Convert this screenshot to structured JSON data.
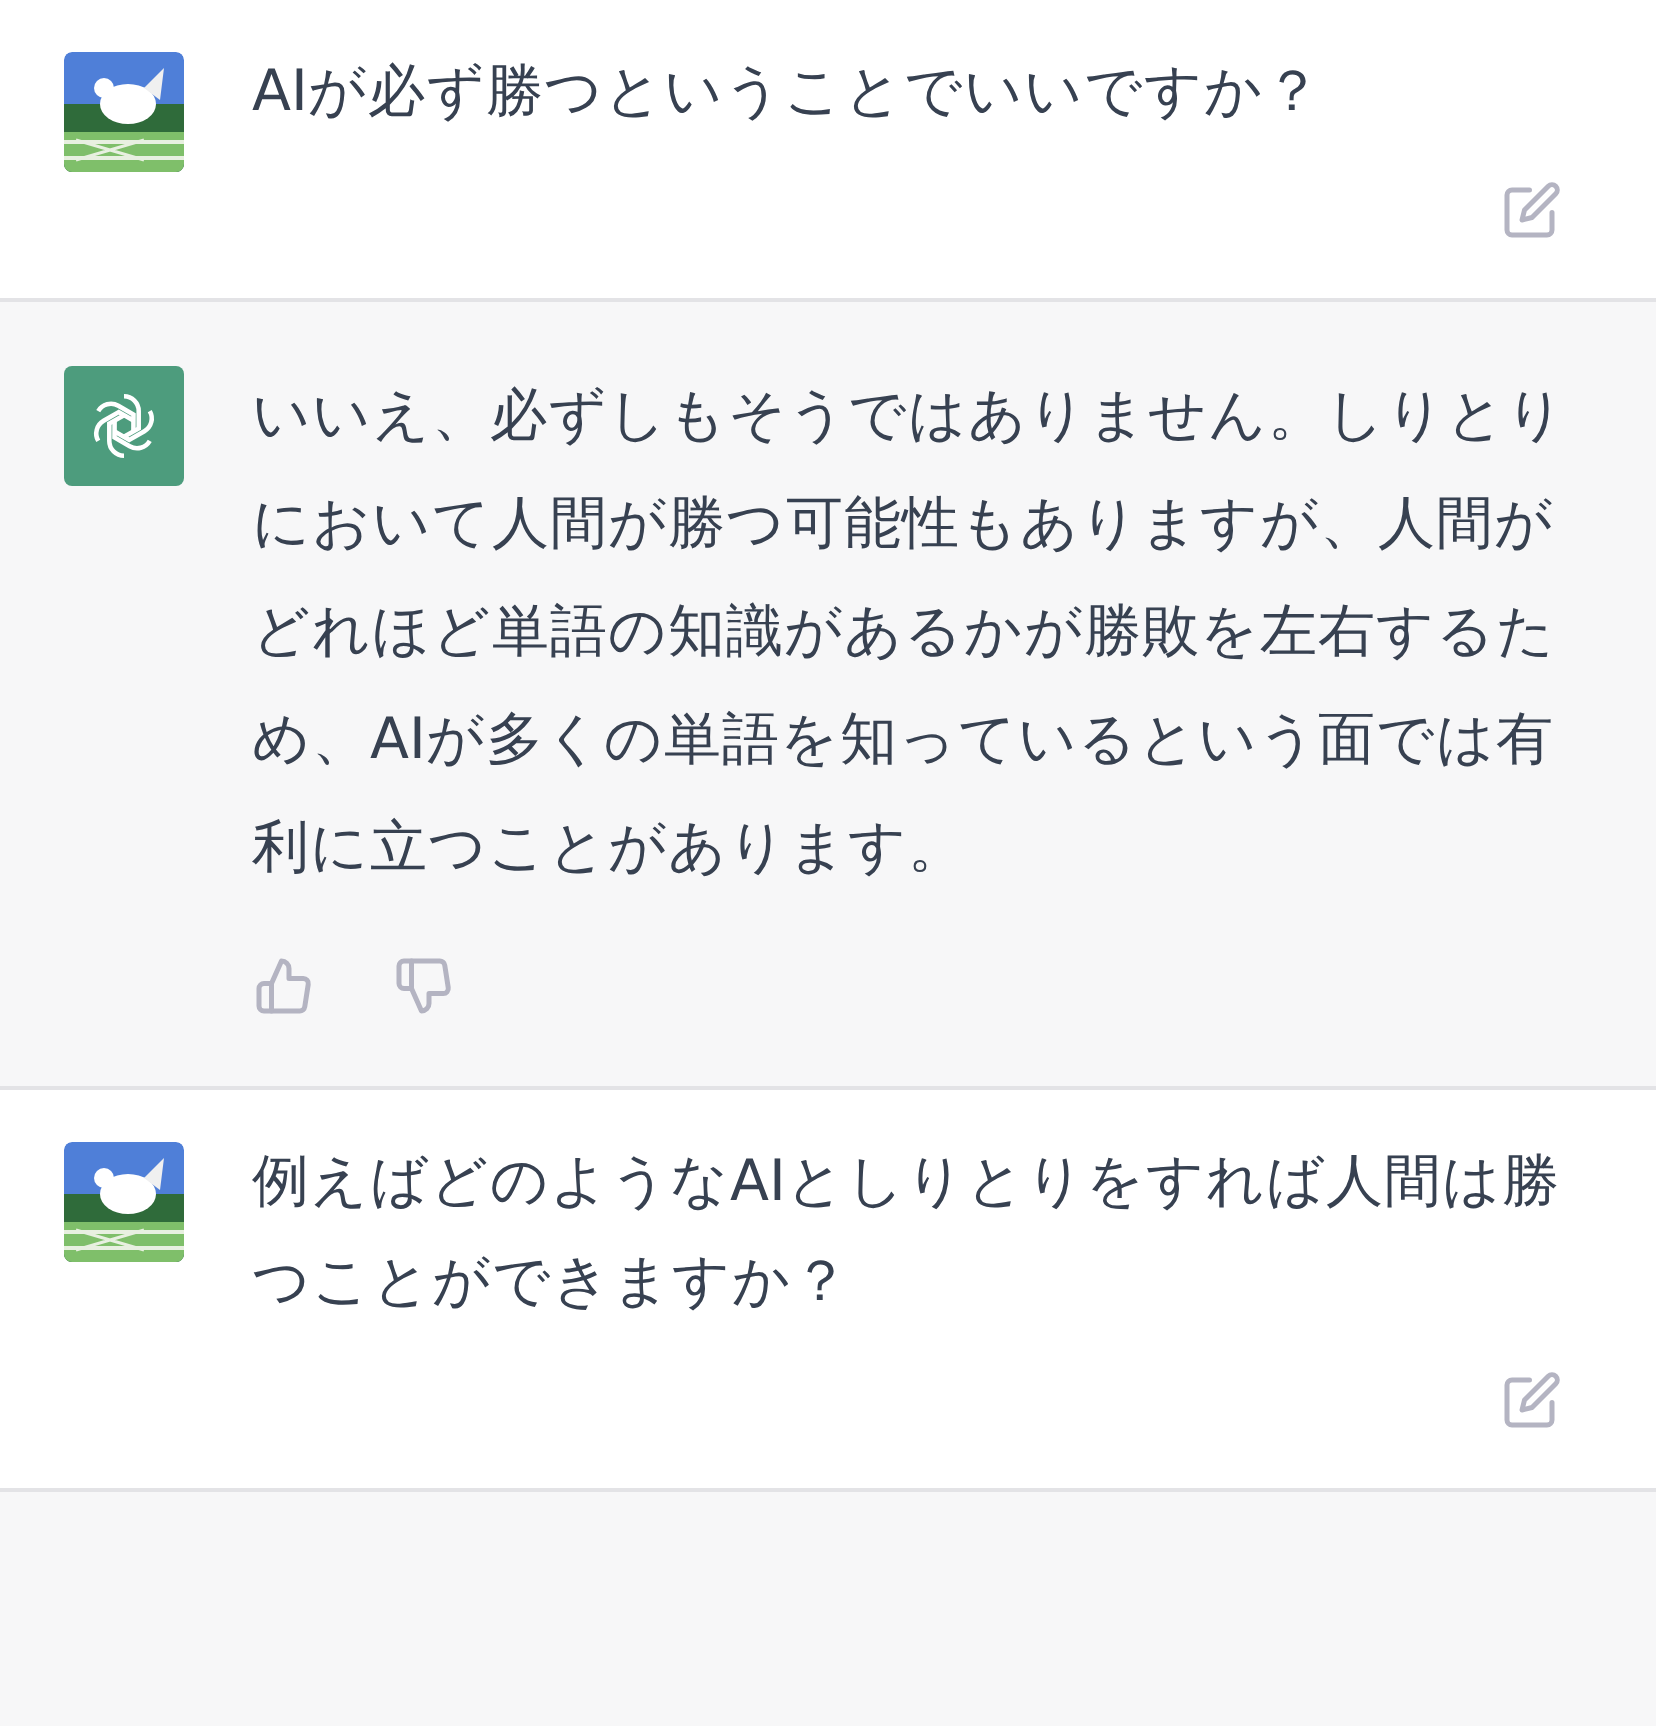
{
  "messages": [
    {
      "kind": "user",
      "text": "AIが必ず勝つということでいいですか？"
    },
    {
      "kind": "assistant",
      "text": "いいえ、必ずしもそうではありません。しりとりにおいて人間が勝つ可能性もありますが、人間がどれほど単語の知識があるかが勝敗を左右するため、AIが多くの単語を知っているという面では有利に立つことがあります。"
    },
    {
      "kind": "user",
      "text": "例えばどのようなAIとしりとりをすれば人間は勝つことができますか？"
    }
  ]
}
